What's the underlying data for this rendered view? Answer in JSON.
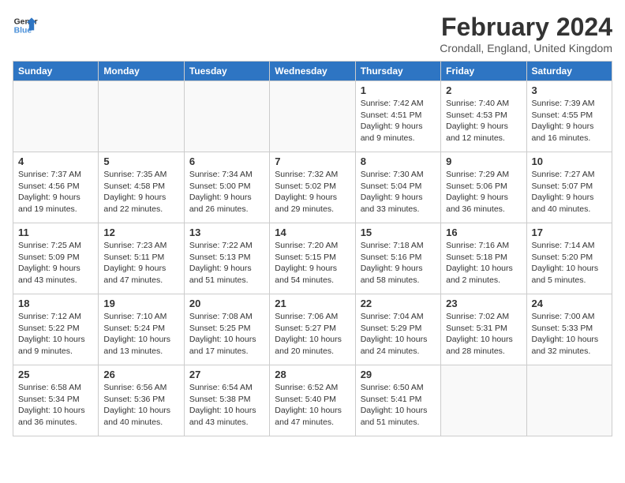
{
  "header": {
    "logo_line1": "General",
    "logo_line2": "Blue",
    "month": "February 2024",
    "location": "Crondall, England, United Kingdom"
  },
  "days_of_week": [
    "Sunday",
    "Monday",
    "Tuesday",
    "Wednesday",
    "Thursday",
    "Friday",
    "Saturday"
  ],
  "weeks": [
    [
      {
        "day": "",
        "sunrise": "",
        "sunset": "",
        "daylight": ""
      },
      {
        "day": "",
        "sunrise": "",
        "sunset": "",
        "daylight": ""
      },
      {
        "day": "",
        "sunrise": "",
        "sunset": "",
        "daylight": ""
      },
      {
        "day": "",
        "sunrise": "",
        "sunset": "",
        "daylight": ""
      },
      {
        "day": "1",
        "sunrise": "Sunrise: 7:42 AM",
        "sunset": "Sunset: 4:51 PM",
        "daylight": "Daylight: 9 hours and 9 minutes."
      },
      {
        "day": "2",
        "sunrise": "Sunrise: 7:40 AM",
        "sunset": "Sunset: 4:53 PM",
        "daylight": "Daylight: 9 hours and 12 minutes."
      },
      {
        "day": "3",
        "sunrise": "Sunrise: 7:39 AM",
        "sunset": "Sunset: 4:55 PM",
        "daylight": "Daylight: 9 hours and 16 minutes."
      }
    ],
    [
      {
        "day": "4",
        "sunrise": "Sunrise: 7:37 AM",
        "sunset": "Sunset: 4:56 PM",
        "daylight": "Daylight: 9 hours and 19 minutes."
      },
      {
        "day": "5",
        "sunrise": "Sunrise: 7:35 AM",
        "sunset": "Sunset: 4:58 PM",
        "daylight": "Daylight: 9 hours and 22 minutes."
      },
      {
        "day": "6",
        "sunrise": "Sunrise: 7:34 AM",
        "sunset": "Sunset: 5:00 PM",
        "daylight": "Daylight: 9 hours and 26 minutes."
      },
      {
        "day": "7",
        "sunrise": "Sunrise: 7:32 AM",
        "sunset": "Sunset: 5:02 PM",
        "daylight": "Daylight: 9 hours and 29 minutes."
      },
      {
        "day": "8",
        "sunrise": "Sunrise: 7:30 AM",
        "sunset": "Sunset: 5:04 PM",
        "daylight": "Daylight: 9 hours and 33 minutes."
      },
      {
        "day": "9",
        "sunrise": "Sunrise: 7:29 AM",
        "sunset": "Sunset: 5:06 PM",
        "daylight": "Daylight: 9 hours and 36 minutes."
      },
      {
        "day": "10",
        "sunrise": "Sunrise: 7:27 AM",
        "sunset": "Sunset: 5:07 PM",
        "daylight": "Daylight: 9 hours and 40 minutes."
      }
    ],
    [
      {
        "day": "11",
        "sunrise": "Sunrise: 7:25 AM",
        "sunset": "Sunset: 5:09 PM",
        "daylight": "Daylight: 9 hours and 43 minutes."
      },
      {
        "day": "12",
        "sunrise": "Sunrise: 7:23 AM",
        "sunset": "Sunset: 5:11 PM",
        "daylight": "Daylight: 9 hours and 47 minutes."
      },
      {
        "day": "13",
        "sunrise": "Sunrise: 7:22 AM",
        "sunset": "Sunset: 5:13 PM",
        "daylight": "Daylight: 9 hours and 51 minutes."
      },
      {
        "day": "14",
        "sunrise": "Sunrise: 7:20 AM",
        "sunset": "Sunset: 5:15 PM",
        "daylight": "Daylight: 9 hours and 54 minutes."
      },
      {
        "day": "15",
        "sunrise": "Sunrise: 7:18 AM",
        "sunset": "Sunset: 5:16 PM",
        "daylight": "Daylight: 9 hours and 58 minutes."
      },
      {
        "day": "16",
        "sunrise": "Sunrise: 7:16 AM",
        "sunset": "Sunset: 5:18 PM",
        "daylight": "Daylight: 10 hours and 2 minutes."
      },
      {
        "day": "17",
        "sunrise": "Sunrise: 7:14 AM",
        "sunset": "Sunset: 5:20 PM",
        "daylight": "Daylight: 10 hours and 5 minutes."
      }
    ],
    [
      {
        "day": "18",
        "sunrise": "Sunrise: 7:12 AM",
        "sunset": "Sunset: 5:22 PM",
        "daylight": "Daylight: 10 hours and 9 minutes."
      },
      {
        "day": "19",
        "sunrise": "Sunrise: 7:10 AM",
        "sunset": "Sunset: 5:24 PM",
        "daylight": "Daylight: 10 hours and 13 minutes."
      },
      {
        "day": "20",
        "sunrise": "Sunrise: 7:08 AM",
        "sunset": "Sunset: 5:25 PM",
        "daylight": "Daylight: 10 hours and 17 minutes."
      },
      {
        "day": "21",
        "sunrise": "Sunrise: 7:06 AM",
        "sunset": "Sunset: 5:27 PM",
        "daylight": "Daylight: 10 hours and 20 minutes."
      },
      {
        "day": "22",
        "sunrise": "Sunrise: 7:04 AM",
        "sunset": "Sunset: 5:29 PM",
        "daylight": "Daylight: 10 hours and 24 minutes."
      },
      {
        "day": "23",
        "sunrise": "Sunrise: 7:02 AM",
        "sunset": "Sunset: 5:31 PM",
        "daylight": "Daylight: 10 hours and 28 minutes."
      },
      {
        "day": "24",
        "sunrise": "Sunrise: 7:00 AM",
        "sunset": "Sunset: 5:33 PM",
        "daylight": "Daylight: 10 hours and 32 minutes."
      }
    ],
    [
      {
        "day": "25",
        "sunrise": "Sunrise: 6:58 AM",
        "sunset": "Sunset: 5:34 PM",
        "daylight": "Daylight: 10 hours and 36 minutes."
      },
      {
        "day": "26",
        "sunrise": "Sunrise: 6:56 AM",
        "sunset": "Sunset: 5:36 PM",
        "daylight": "Daylight: 10 hours and 40 minutes."
      },
      {
        "day": "27",
        "sunrise": "Sunrise: 6:54 AM",
        "sunset": "Sunset: 5:38 PM",
        "daylight": "Daylight: 10 hours and 43 minutes."
      },
      {
        "day": "28",
        "sunrise": "Sunrise: 6:52 AM",
        "sunset": "Sunset: 5:40 PM",
        "daylight": "Daylight: 10 hours and 47 minutes."
      },
      {
        "day": "29",
        "sunrise": "Sunrise: 6:50 AM",
        "sunset": "Sunset: 5:41 PM",
        "daylight": "Daylight: 10 hours and 51 minutes."
      },
      {
        "day": "",
        "sunrise": "",
        "sunset": "",
        "daylight": ""
      },
      {
        "day": "",
        "sunrise": "",
        "sunset": "",
        "daylight": ""
      }
    ]
  ]
}
